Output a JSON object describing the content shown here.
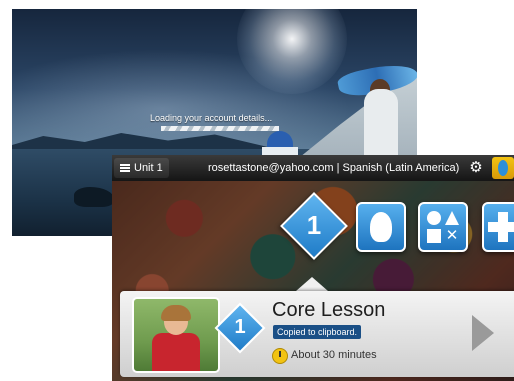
{
  "loading": {
    "message": "Loading your account details..."
  },
  "app": {
    "unit_label": "Unit 1",
    "account_info": "rosettastone@yahoo.com | Spanish (Latin America)",
    "lesson": {
      "number": "1",
      "card_number": "1",
      "title": "Core Lesson",
      "tooltip": "Copied to clipboard.",
      "duration": "About 30 minutes"
    }
  },
  "colors": {
    "accent_blue": "#1f7cc8",
    "logo_yellow": "#f2c312",
    "tooltip_bg": "#1a4f86"
  },
  "icons": [
    "menu-icon",
    "gear-icon",
    "rosetta-stone-logo",
    "pronunciation-icon",
    "vocabulary-icon",
    "add-icon",
    "clock-icon",
    "next-arrow-icon"
  ]
}
